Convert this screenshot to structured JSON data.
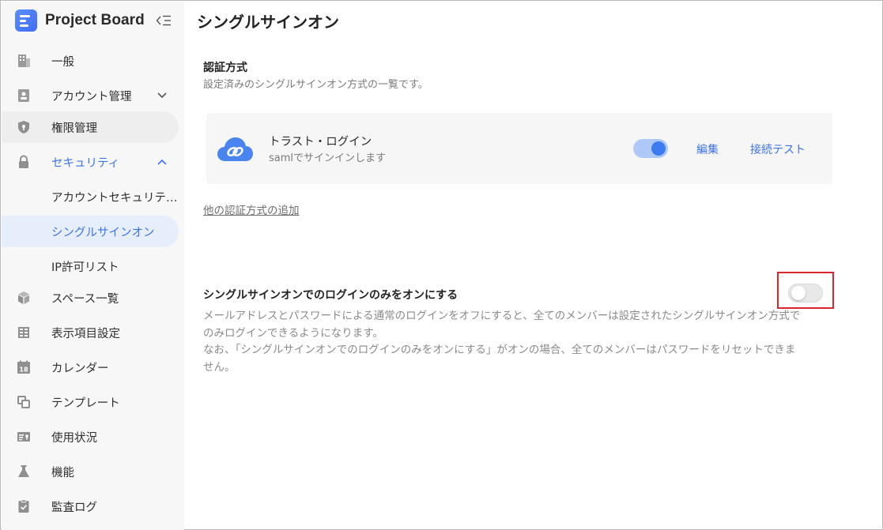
{
  "app": {
    "title": "Project Board"
  },
  "sidebar": {
    "items": [
      {
        "label": "一般",
        "icon": "building-icon"
      },
      {
        "label": "アカウント管理",
        "icon": "account-card-icon",
        "expandable": true,
        "expanded": false
      },
      {
        "label": "権限管理",
        "icon": "shield-icon"
      },
      {
        "label": "セキュリティ",
        "icon": "lock-icon",
        "expandable": true,
        "expanded": true
      },
      {
        "label": "アカウントセキュリテ…"
      },
      {
        "label": "シングルサインオン",
        "active": true
      },
      {
        "label": "IP許可リスト"
      },
      {
        "label": "スペース一覧",
        "icon": "cube-icon"
      },
      {
        "label": "表示項目設定",
        "icon": "table-icon"
      },
      {
        "label": "カレンダー",
        "icon": "calendar-icon"
      },
      {
        "label": "テンプレート",
        "icon": "template-icon"
      },
      {
        "label": "使用状況",
        "icon": "usage-icon"
      },
      {
        "label": "機能",
        "icon": "flask-icon"
      },
      {
        "label": "監査ログ",
        "icon": "clipboard-icon"
      }
    ]
  },
  "main": {
    "page_title": "シングルサインオン",
    "auth_section": {
      "title": "認証方式",
      "description": "設定済みのシングルサインオン方式の一覧です。",
      "provider": {
        "name": "トラスト・ログイン",
        "subtitle": "samlでサインインします",
        "enabled": true,
        "edit_label": "編集",
        "test_label": "接続テスト"
      },
      "add_link": "他の認証方式の追加"
    },
    "sso_only": {
      "title": "シングルサインオンでのログインのみをオンにする",
      "enabled": false,
      "desc_line1": "メールアドレスとパスワードによる通常のログインをオフにすると、全てのメンバーは設定されたシングルサインオン方式で",
      "desc_line2": "のみログインできるようになります。",
      "desc_line3": "なお、「シングルサインオンでのログインのみをオンにする」がオンの場合、全てのメンバーはパスワードをリセットできま",
      "desc_line4": "せん。"
    }
  },
  "colors": {
    "accent": "#3c74e8",
    "active_bg": "#e6eefc",
    "sidebar_bg": "#f7f7f7",
    "highlight": "#d9262c"
  }
}
